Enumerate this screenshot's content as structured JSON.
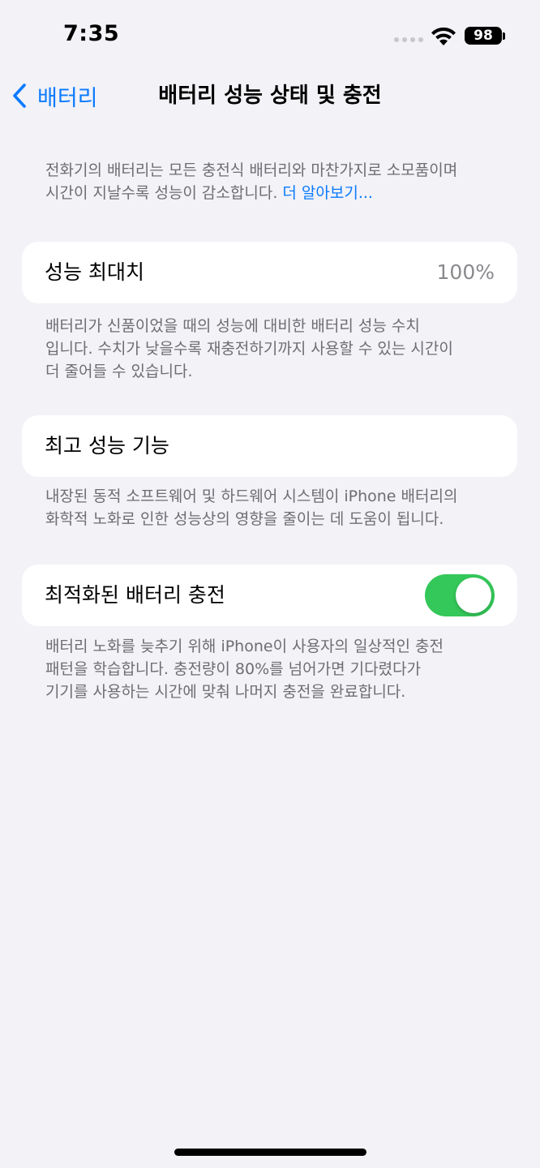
{
  "status_bar": {
    "time": "7:35",
    "battery_level": "98",
    "icons": [
      "signal-icon",
      "wifi-icon",
      "battery-icon"
    ]
  },
  "nav": {
    "back_label": "배터리",
    "title": "배터리 성능 상태 및 충전"
  },
  "intro": {
    "line1": "전화기의 배터리는 모든 충전식 배터리와 마찬가지로 소모품이며",
    "line2": "시간이 지날수록 성능이 감소합니다.",
    "link": "더 알아보기..."
  },
  "maximum_capacity": {
    "label": "성능 최대치",
    "value": "100%",
    "footnote_line1": "배터리가 신품이었을 때의 성능에 대비한 배터리 성능 수치",
    "footnote_line2": "입니다. 수치가 낮을수록 재충전하기까지 사용할 수 있는 시간이",
    "footnote_line3": "더 줄어들 수 있습니다."
  },
  "peak_performance": {
    "label": "최고 성능 기능",
    "footnote_line1": "내장된 동적 소프트웨어 및 하드웨어 시스템이 iPhone 배터리의",
    "footnote_line2": "화학적 노화로 인한 성능상의 영향을 줄이는 데 도움이 됩니다."
  },
  "optimized_charging": {
    "label": "최적화된 배터리 충전",
    "enabled": true,
    "footnote_line1": "배터리 노화를 늦추기 위해 iPhone이 사용자의 일상적인 충전",
    "footnote_line2": "패턴을 학습합니다. 충전량이 80%를 넘어가면 기다렸다가",
    "footnote_line3": "기기를 사용하는 시간에 맞춰 나머지 충전을 완료합니다."
  },
  "colors": {
    "accent": "#0a7aff",
    "toggle_on": "#34c759",
    "background": "#f2f2f7",
    "secondary_text": "#6d6d72"
  }
}
